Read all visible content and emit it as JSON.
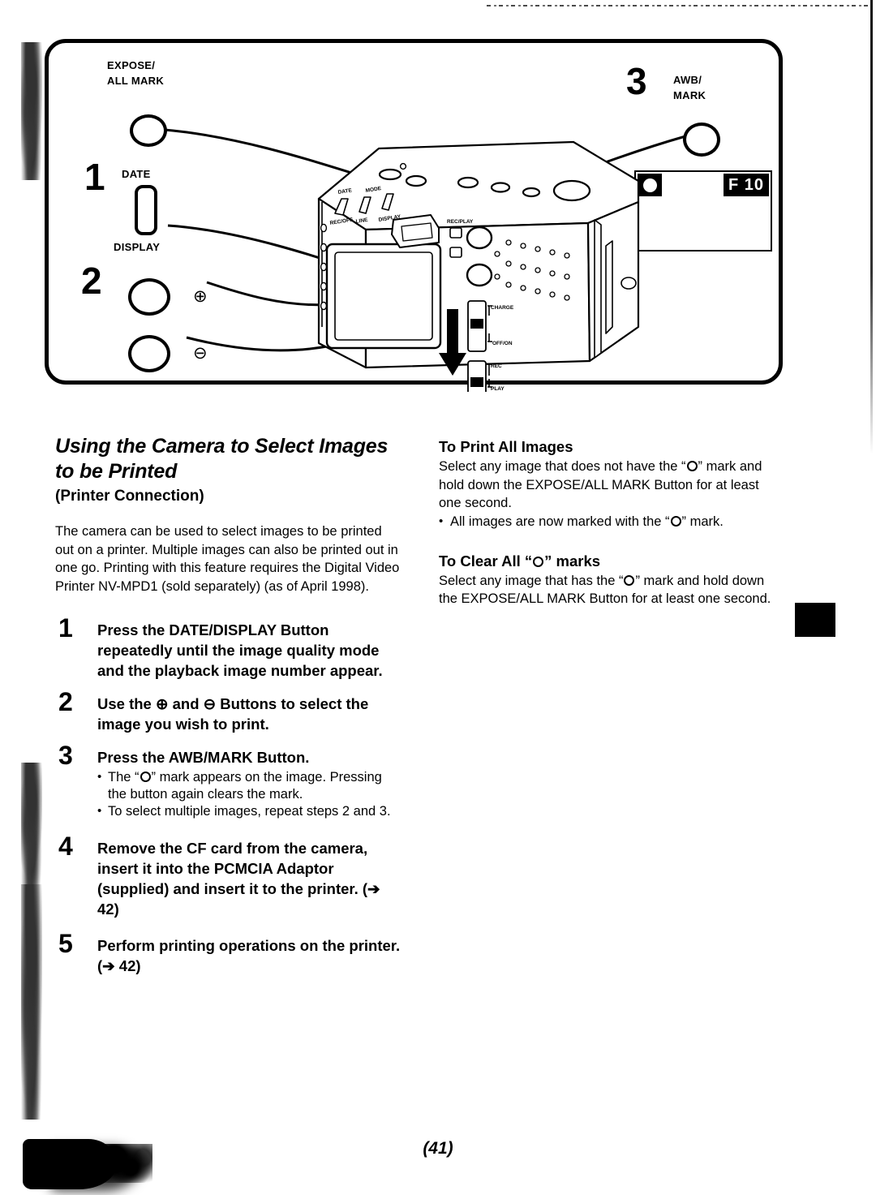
{
  "figure": {
    "callouts": [
      {
        "id": "expose-all-mark",
        "label": "EXPOSE/\nALL MARK",
        "step": "1"
      },
      {
        "id": "date-display",
        "label_top": "DATE",
        "label_bottom": "DISPLAY",
        "step": "2"
      },
      {
        "id": "awb-mark",
        "label": "AWB/\nMARK",
        "step": "3"
      }
    ],
    "step_numbers": {
      "one": "1",
      "two": "2",
      "three": "3"
    },
    "plus_symbol": "⊕",
    "minus_symbol": "⊖",
    "lcd": {
      "mark_icon": "o-mark-icon",
      "quality_mode": "F",
      "image_number": "10",
      "display_text": "F 10"
    },
    "camera_labels": {
      "recplay": "REC/PLAY",
      "charge": "CHARGE",
      "off": "OFF",
      "on": "ON",
      "rec": "REC",
      "play": "PLAY"
    }
  },
  "left_column": {
    "title": "Using the Camera to Select Images to be Printed",
    "subtitle": "(Printer Connection)",
    "intro": "The camera can be used to select images to be printed out on a printer. Multiple images can also be printed out in one go. Printing with this feature requires the Digital Video Printer NV-MPD1 (sold separately) (as of April 1998).",
    "steps": [
      {
        "number": "1",
        "text": "Press the DATE/DISPLAY Button repeatedly until the image quality mode and the playback image number appear.",
        "bullets": []
      },
      {
        "number": "2",
        "text_before": "Use the ",
        "plus": "⊕",
        "text_mid": " and ",
        "minus": "⊖",
        "text_after": " Buttons to select the image you wish to print.",
        "bullets": []
      },
      {
        "number": "3",
        "text": "Press the AWB/MARK Button.",
        "bullets": [
          {
            "before": "The “",
            "after": "” mark appears on the image. Pressing the button again clears the mark."
          },
          {
            "plain": "To select multiple images, repeat steps 2 and 3."
          }
        ]
      },
      {
        "number": "4",
        "text": "Remove the CF card from the camera, insert it into the PCMCIA Adaptor (supplied) and insert it to the printer. (➔ 42)",
        "bullets": []
      },
      {
        "number": "5",
        "text": "Perform printing operations on the printer. (➔ 42)",
        "bullets": []
      }
    ]
  },
  "right_column": {
    "sections": [
      {
        "heading": "To Print All Images",
        "body_before": "Select any image that does not have the “",
        "body_after": "” mark and hold down the EXPOSE/ALL MARK Button for at least one second.",
        "bullet_before": "All images are now marked with the “",
        "bullet_after": "” mark."
      },
      {
        "heading_before": "To Clear All “",
        "heading_after": "” marks",
        "body_before": "Select any image that has the “",
        "body_after": "” mark and hold down the EXPOSE/ALL MARK Button for at least one second."
      }
    ]
  },
  "footer": {
    "page_number": "(41)"
  }
}
